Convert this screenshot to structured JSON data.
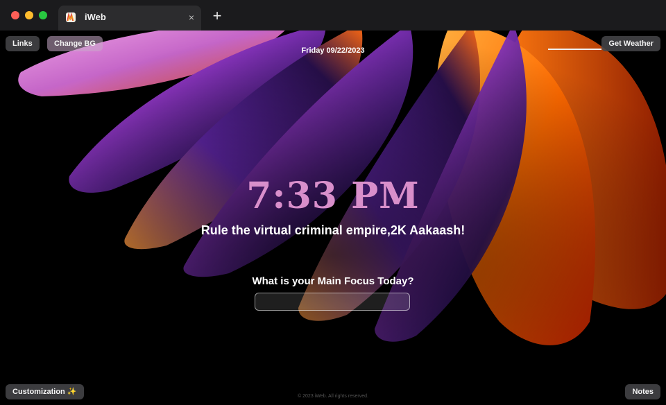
{
  "browser": {
    "tab_title": "iWeb",
    "tab_close_glyph": "×",
    "new_tab_glyph": "+"
  },
  "header": {
    "links_label": "Links",
    "change_bg_label": "Change BG",
    "date": "Friday 09/22/2023",
    "weather_label": "Get Weather"
  },
  "main": {
    "time": "7:33 PM",
    "greeting": "Rule the virtual criminal empire,2K Aakaash!",
    "focus_question": "What is your Main Focus Today?",
    "focus_value": ""
  },
  "footer": {
    "customization_label": "Customization ✨",
    "notes_label": "Notes",
    "copyright": "© 2023 iWeb. All rights reserved."
  },
  "colors": {
    "clock": "#d98fcb",
    "background": "#000000",
    "accent_orange": "#ff6a00"
  },
  "icons": {
    "favicon": "iweb-logo-icon",
    "close": "close-icon",
    "new_tab": "plus-icon"
  }
}
